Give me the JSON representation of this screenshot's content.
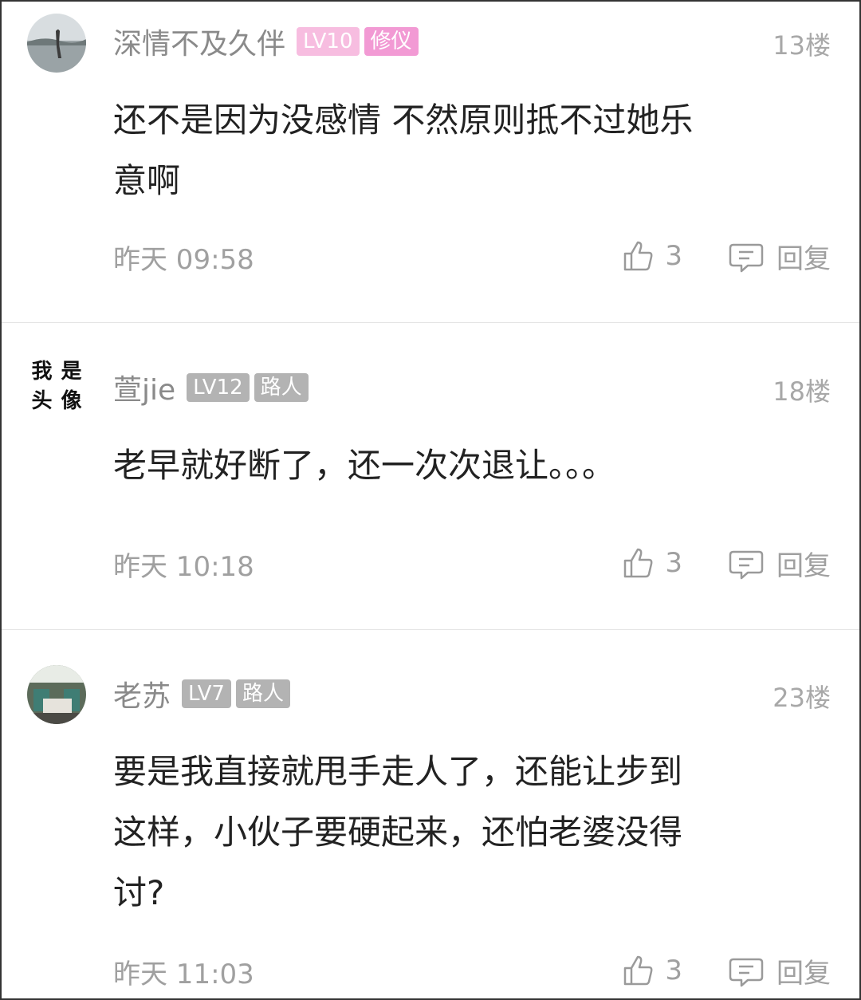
{
  "comments": [
    {
      "username": "深情不及久伴",
      "level": "LV10",
      "title": "修仪",
      "floor": "13楼",
      "content_lines": [
        "还不是因为没感情 不然原则抵不过她乐",
        "意啊"
      ],
      "time": "昨天 09:58",
      "likes": "3",
      "reply": "回复"
    },
    {
      "username": "萱jie",
      "level": "LV12",
      "title": "路人",
      "floor": "18楼",
      "avatar_text": [
        "我",
        "是",
        "头",
        "像"
      ],
      "content_lines": [
        "老早就好断了，还一次次退让。。。"
      ],
      "time": "昨天 10:18",
      "likes": "3",
      "reply": "回复"
    },
    {
      "username": "老苏",
      "level": "LV7",
      "title": "路人",
      "floor": "23楼",
      "content_lines": [
        "要是我直接就甩手走人了，还能让步到",
        "这样，小伙子要硬起来，还怕老婆没得",
        "讨?"
      ],
      "time": "昨天 11:03",
      "likes": "3",
      "reply": "回复"
    }
  ]
}
